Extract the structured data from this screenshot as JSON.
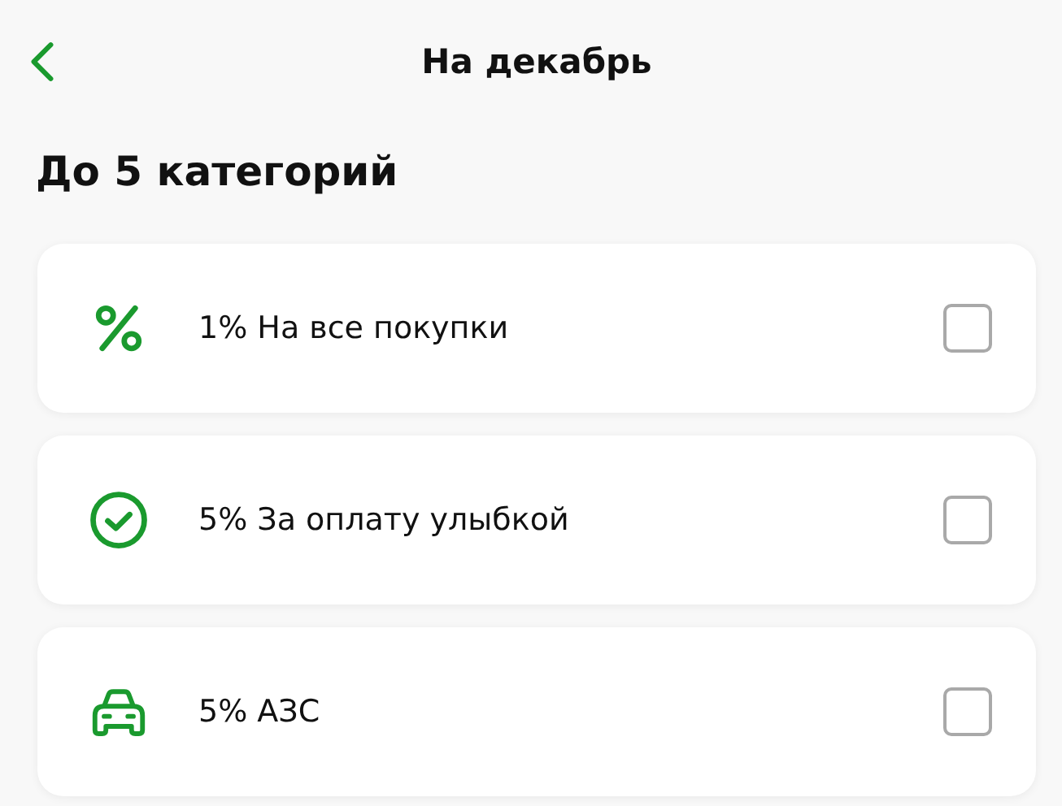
{
  "header": {
    "title": "На декабрь"
  },
  "section": {
    "title": "До 5 категорий"
  },
  "categories": [
    {
      "kind": "percent",
      "label": "1% На все покупки",
      "checked": false
    },
    {
      "kind": "check-circle",
      "label": "5% За оплату улыбкой",
      "checked": false
    },
    {
      "kind": "car",
      "label": "5% АЗС",
      "checked": false
    }
  ]
}
